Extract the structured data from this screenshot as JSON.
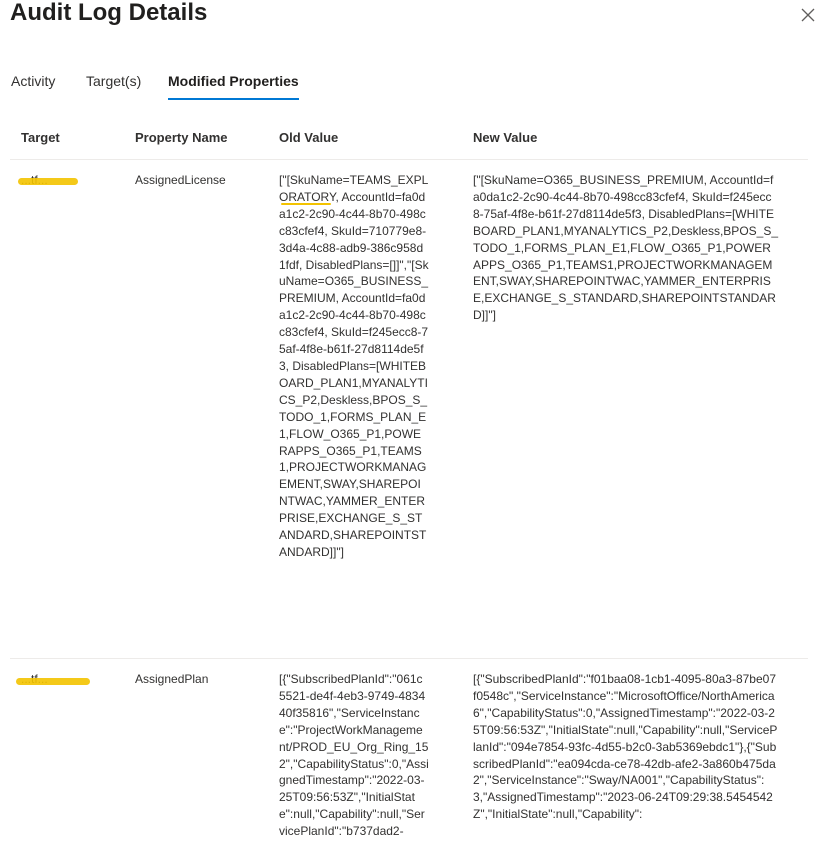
{
  "dialog": {
    "title": "Audit Log Details",
    "close_icon": "close-icon"
  },
  "tabs": [
    {
      "label": "Activity",
      "active": false
    },
    {
      "label": "Target(s)",
      "active": false
    },
    {
      "label": "Modified Properties",
      "active": true
    }
  ],
  "table": {
    "columns": [
      "Target",
      "Property Name",
      "Old Value",
      "New Value"
    ],
    "rows": [
      {
        "target": "...tf...",
        "property": "AssignedLicense",
        "old_value": "[\"[SkuName=TEAMS_EXPLORATORY, AccountId=fa0da1c2-2c90-4c44-8b70-498cc83cfef4, SkuId=710779e8-3d4a-4c88-adb9-386c958d1fdf, DisabledPlans=[]]\",\"[SkuName=O365_BUSINESS_PREMIUM, AccountId=fa0da1c2-2c90-4c44-8b70-498cc83cfef4, SkuId=f245ecc8-75af-4f8e-b61f-27d8114de5f3, DisabledPlans=[WHITEBOARD_PLAN1,MYANALYTICS_P2,Deskless,BPOS_S_TODO_1,FORMS_PLAN_E1,FLOW_O365_P1,POWERAPPS_O365_P1,TEAMS1,PROJECTWORKMANAGEMENT,SWAY,SHAREPOINTWAC,YAMMER_ENTERPRISE,EXCHANGE_S_STANDARD,SHAREPOINTSTANDARD]]\"]",
        "new_value": "[\"[SkuName=O365_BUSINESS_PREMIUM, AccountId=fa0da1c2-2c90-4c44-8b70-498cc83cfef4, SkuId=f245ecc8-75af-4f8e-b61f-27d8114de5f3, DisabledPlans=[WHITEBOARD_PLAN1,MYANALYTICS_P2,Deskless,BPOS_S_TODO_1,FORMS_PLAN_E1,FLOW_O365_P1,POWERAPPS_O365_P1,TEAMS1,PROJECTWORKMANAGEMENT,SWAY,SHAREPOINTWAC,YAMMER_ENTERPRISE,EXCHANGE_S_STANDARD,SHAREPOINTSTANDARD]]\"]"
      },
      {
        "target": "...tf...",
        "property": "AssignedPlan",
        "old_value": "[{\"SubscribedPlanId\":\"061c5521-de4f-4eb3-9749-483440f35816\",\"ServiceInstance\":\"ProjectWorkManagement/PROD_EU_Org_Ring_152\",\"CapabilityStatus\":0,\"AssignedTimestamp\":\"2022-03-25T09:56:53Z\",\"InitialState\":null,\"Capability\":null,\"ServicePlanId\":\"b737dad2-",
        "new_value": "[{\"SubscribedPlanId\":\"f01baa08-1cb1-4095-80a3-87be07f0548c\",\"ServiceInstance\":\"MicrosoftOffice/NorthAmerica6\",\"CapabilityStatus\":0,\"AssignedTimestamp\":\"2022-03-25T09:56:53Z\",\"InitialState\":null,\"Capability\":null,\"ServicePlanId\":\"094e7854-93fc-4d55-b2c0-3ab5369ebdc1\"},{\"SubscribedPlanId\":\"ea094cda-ce78-42db-afe2-3a860b475da2\",\"ServiceInstance\":\"Sway/NA001\",\"CapabilityStatus\":3,\"AssignedTimestamp\":\"2023-06-24T09:29:38.5454542Z\",\"InitialState\":null,\"Capability\":"
      }
    ]
  },
  "colors": {
    "accent": "#0078d4",
    "redaction": "#f3c300",
    "divider": "#edebe9"
  }
}
